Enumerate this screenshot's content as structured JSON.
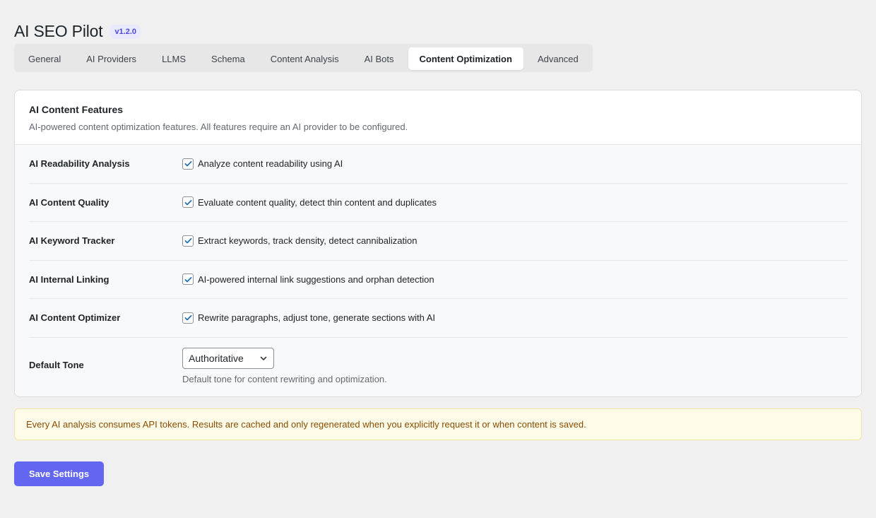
{
  "app": {
    "title": "AI SEO Pilot",
    "version": "v1.2.0"
  },
  "tabs": [
    {
      "label": "General"
    },
    {
      "label": "AI Providers"
    },
    {
      "label": "LLMS"
    },
    {
      "label": "Schema"
    },
    {
      "label": "Content Analysis"
    },
    {
      "label": "AI Bots"
    },
    {
      "label": "Content Optimization",
      "active": true
    },
    {
      "label": "Advanced"
    }
  ],
  "card": {
    "title": "AI Content Features",
    "description": "AI-powered content optimization features. All features require an AI provider to be configured.",
    "settings": [
      {
        "label": "AI Readability Analysis",
        "checked": true,
        "text": "Analyze content readability using AI"
      },
      {
        "label": "AI Content Quality",
        "checked": true,
        "text": "Evaluate content quality, detect thin content and duplicates"
      },
      {
        "label": "AI Keyword Tracker",
        "checked": true,
        "text": "Extract keywords, track density, detect cannibalization"
      },
      {
        "label": "AI Internal Linking",
        "checked": true,
        "text": "AI-powered internal link suggestions and orphan detection"
      },
      {
        "label": "AI Content Optimizer",
        "checked": true,
        "text": "Rewrite paragraphs, adjust tone, generate sections with AI"
      }
    ],
    "tone": {
      "label": "Default Tone",
      "value": "Authoritative",
      "hint": "Default tone for content rewriting and optimization."
    }
  },
  "notice": "Every AI analysis consumes API tokens. Results are cached and only regenerated when you explicitly request it or when content is saved.",
  "save_button": "Save Settings",
  "colors": {
    "accent": "#6366f1",
    "notice_bg": "#fefbe8",
    "notice_text": "#8a4b00",
    "check": "#2271b1"
  },
  "icons": {
    "checkbox": "checkmark-icon",
    "select": "chevron-down-icon"
  }
}
